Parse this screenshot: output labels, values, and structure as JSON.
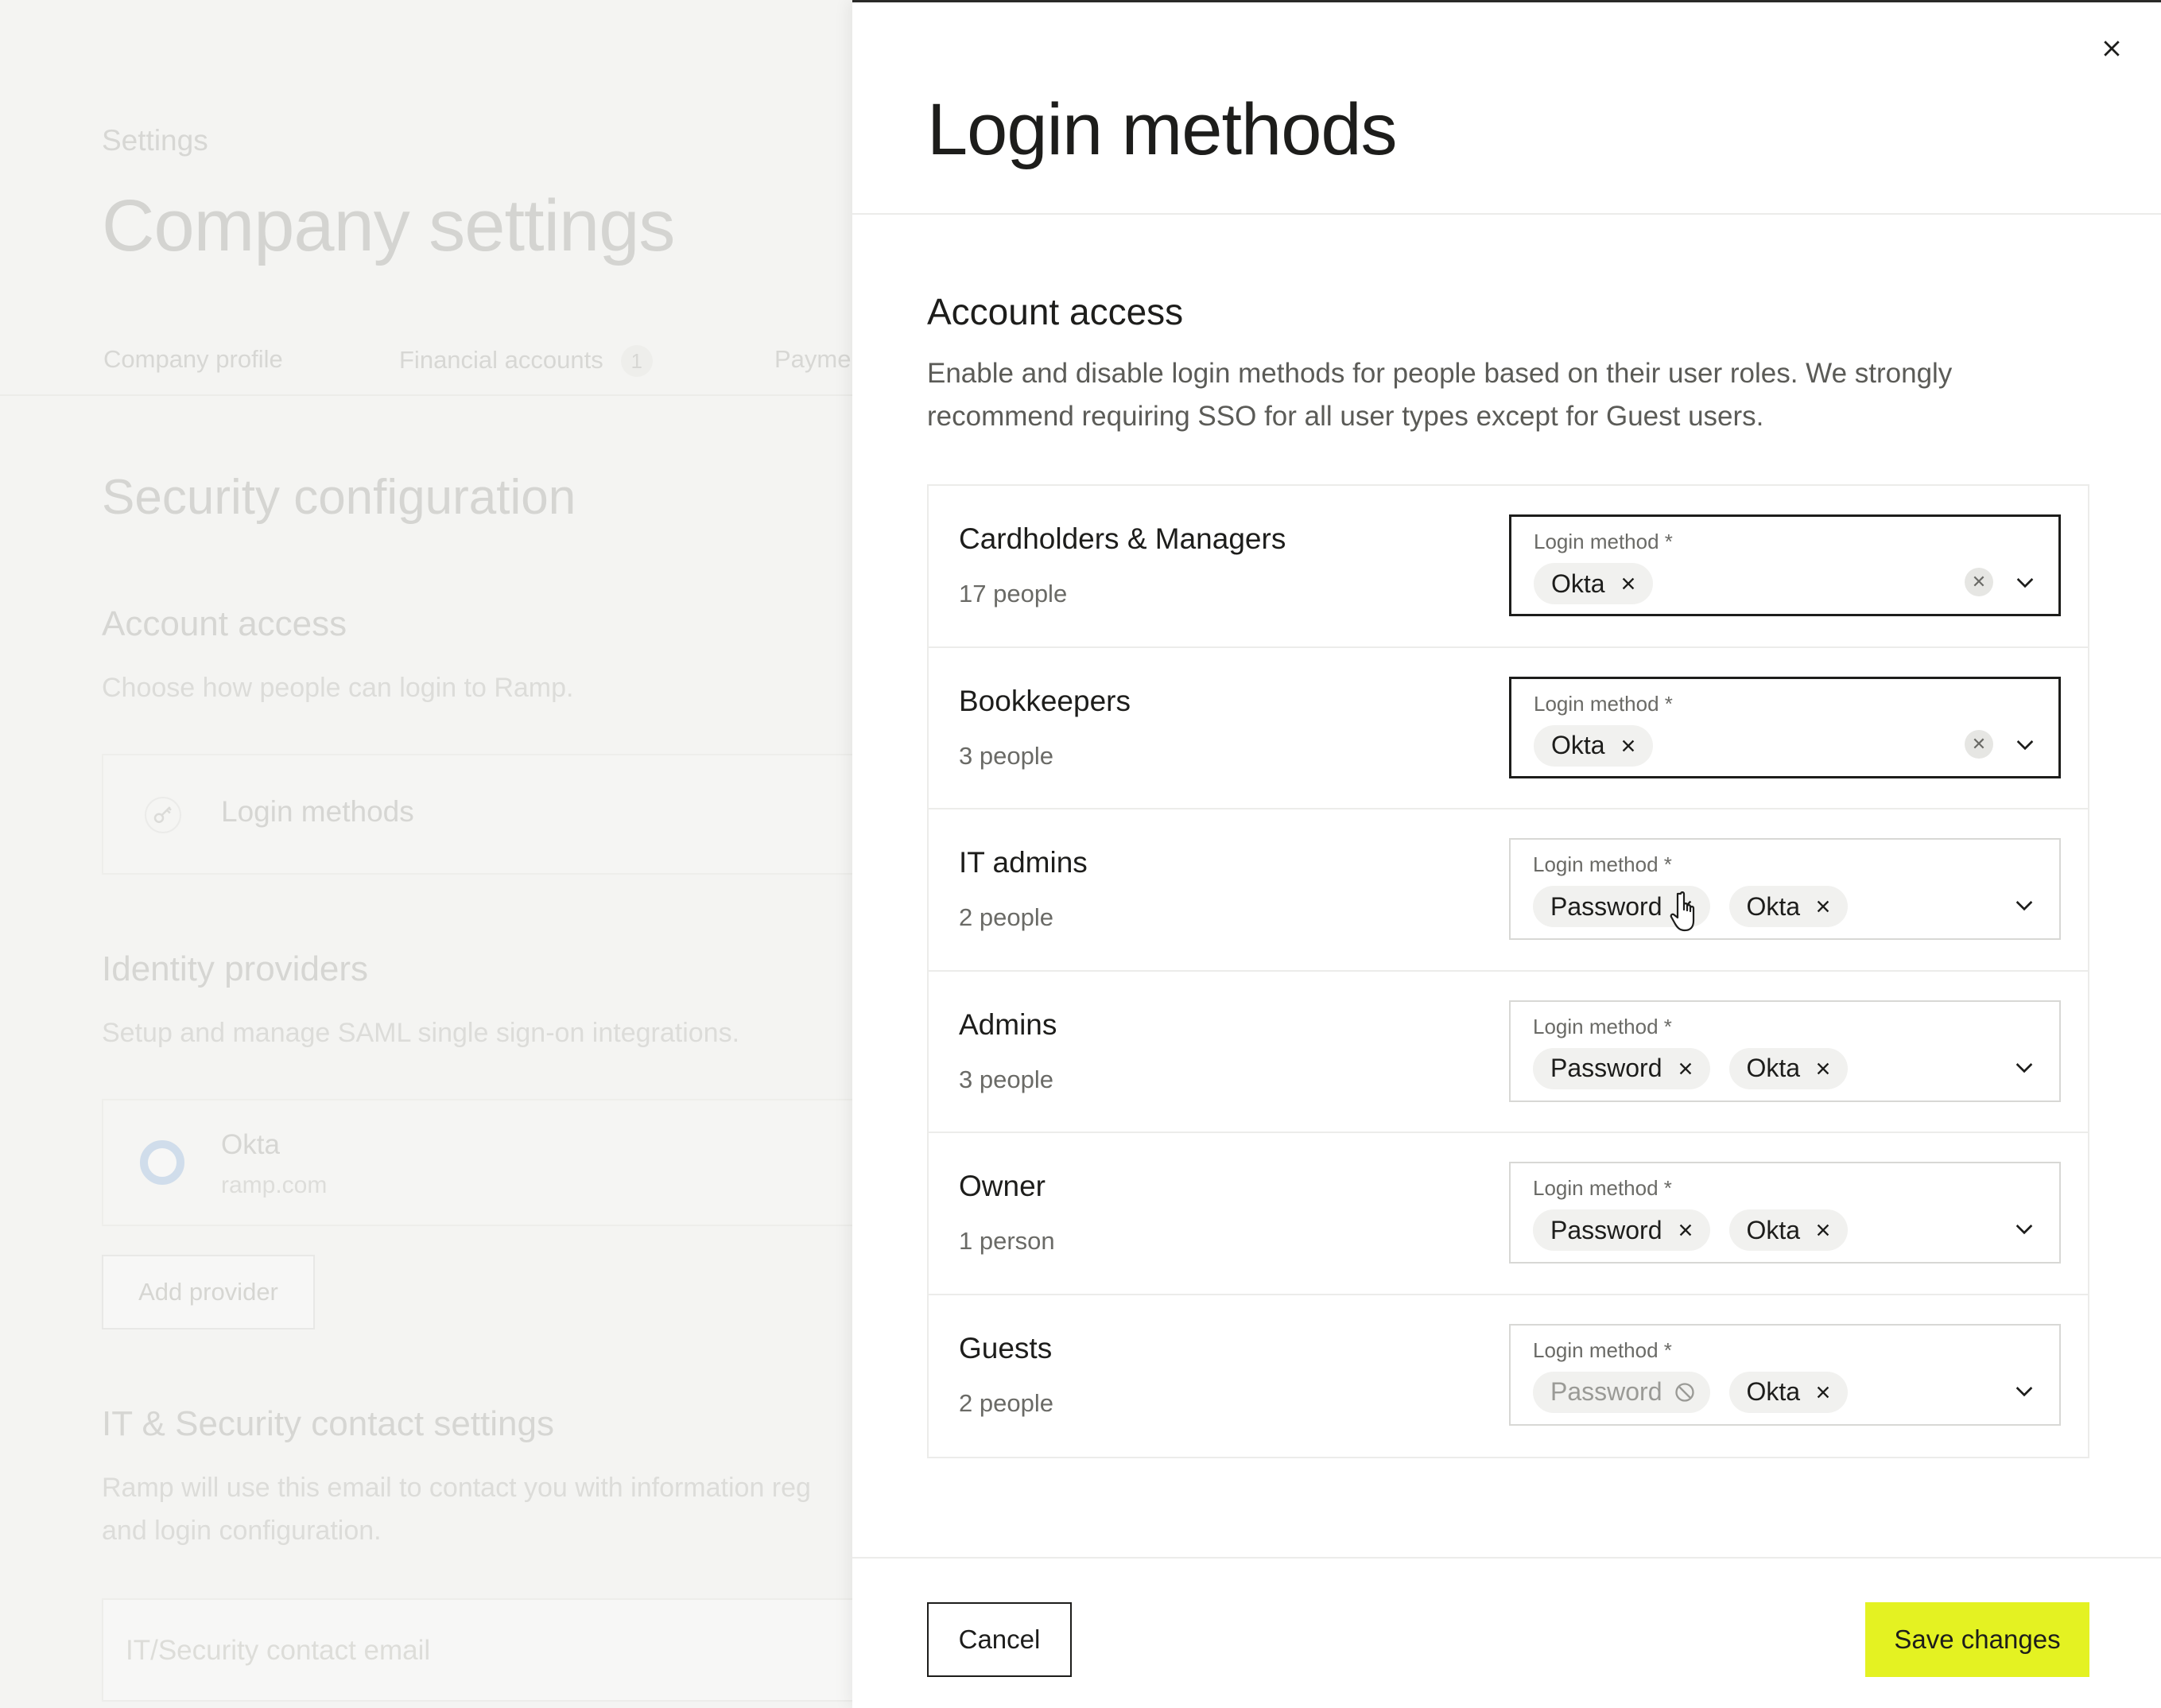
{
  "background": {
    "breadcrumb": "Settings",
    "title": "Company settings",
    "tabs": [
      {
        "label": "Company profile"
      },
      {
        "label": "Financial accounts",
        "badge": "1"
      },
      {
        "label": "Payme"
      }
    ],
    "security_heading": "Security configuration",
    "account_access": {
      "heading": "Account access",
      "desc": "Choose how people can login to Ramp.",
      "card_label": "Login methods",
      "card_icon": "key-icon"
    },
    "identity_providers": {
      "heading": "Identity providers",
      "desc": "Setup and manage SAML single sign-on integrations.",
      "provider_name": "Okta",
      "provider_domain": "ramp.com",
      "add_button": "Add provider"
    },
    "contact": {
      "heading": "IT & Security contact settings",
      "desc_line1": "Ramp will use this email to contact you with information reg",
      "desc_line2": "and login configuration.",
      "input_placeholder": "IT/Security contact email"
    }
  },
  "drawer": {
    "title": "Login methods",
    "close_icon": "close-icon",
    "section_title": "Account access",
    "section_desc": "Enable and disable login methods for people based on their user roles. We strongly recommend requiring SSO for all user types except for Guest users.",
    "field_label": "Login method *",
    "roles": [
      {
        "name": "Cardholders & Managers",
        "count": "17 people",
        "chips": [
          {
            "label": "Okta",
            "removable": true
          }
        ],
        "clearable": true,
        "focused": true
      },
      {
        "name": "Bookkeepers",
        "count": "3 people",
        "chips": [
          {
            "label": "Okta",
            "removable": true
          }
        ],
        "clearable": true,
        "focused": true
      },
      {
        "name": "IT admins",
        "count": "2 people",
        "chips": [
          {
            "label": "Password",
            "removable": true
          },
          {
            "label": "Okta",
            "removable": true
          }
        ],
        "clearable": false,
        "focused": false
      },
      {
        "name": "Admins",
        "count": "3 people",
        "chips": [
          {
            "label": "Password",
            "removable": true
          },
          {
            "label": "Okta",
            "removable": true
          }
        ],
        "clearable": false,
        "focused": false
      },
      {
        "name": "Owner",
        "count": "1 person",
        "chips": [
          {
            "label": "Password",
            "removable": true
          },
          {
            "label": "Okta",
            "removable": true
          }
        ],
        "clearable": false,
        "focused": false
      },
      {
        "name": "Guests",
        "count": "2 people",
        "chips": [
          {
            "label": "Password",
            "removable": false,
            "disabled": true
          },
          {
            "label": "Okta",
            "removable": true
          }
        ],
        "clearable": false,
        "focused": false
      }
    ],
    "cancel_label": "Cancel",
    "save_label": "Save changes",
    "accent_color": "#e4f222"
  }
}
